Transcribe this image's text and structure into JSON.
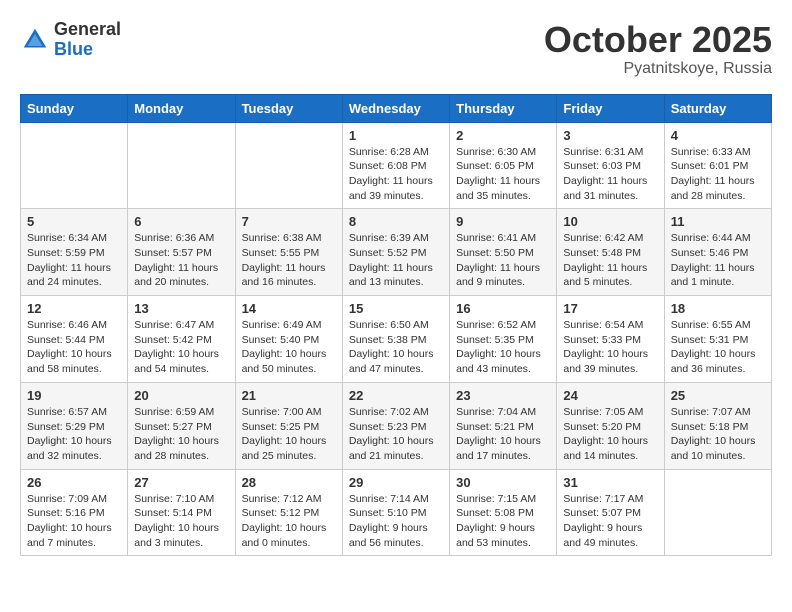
{
  "logo": {
    "general": "General",
    "blue": "Blue"
  },
  "header": {
    "month": "October 2025",
    "location": "Pyatnitskoye, Russia"
  },
  "weekdays": [
    "Sunday",
    "Monday",
    "Tuesday",
    "Wednesday",
    "Thursday",
    "Friday",
    "Saturday"
  ],
  "weeks": [
    [
      {
        "day": "",
        "info": ""
      },
      {
        "day": "",
        "info": ""
      },
      {
        "day": "",
        "info": ""
      },
      {
        "day": "1",
        "info": "Sunrise: 6:28 AM\nSunset: 6:08 PM\nDaylight: 11 hours\nand 39 minutes."
      },
      {
        "day": "2",
        "info": "Sunrise: 6:30 AM\nSunset: 6:05 PM\nDaylight: 11 hours\nand 35 minutes."
      },
      {
        "day": "3",
        "info": "Sunrise: 6:31 AM\nSunset: 6:03 PM\nDaylight: 11 hours\nand 31 minutes."
      },
      {
        "day": "4",
        "info": "Sunrise: 6:33 AM\nSunset: 6:01 PM\nDaylight: 11 hours\nand 28 minutes."
      }
    ],
    [
      {
        "day": "5",
        "info": "Sunrise: 6:34 AM\nSunset: 5:59 PM\nDaylight: 11 hours\nand 24 minutes."
      },
      {
        "day": "6",
        "info": "Sunrise: 6:36 AM\nSunset: 5:57 PM\nDaylight: 11 hours\nand 20 minutes."
      },
      {
        "day": "7",
        "info": "Sunrise: 6:38 AM\nSunset: 5:55 PM\nDaylight: 11 hours\nand 16 minutes."
      },
      {
        "day": "8",
        "info": "Sunrise: 6:39 AM\nSunset: 5:52 PM\nDaylight: 11 hours\nand 13 minutes."
      },
      {
        "day": "9",
        "info": "Sunrise: 6:41 AM\nSunset: 5:50 PM\nDaylight: 11 hours\nand 9 minutes."
      },
      {
        "day": "10",
        "info": "Sunrise: 6:42 AM\nSunset: 5:48 PM\nDaylight: 11 hours\nand 5 minutes."
      },
      {
        "day": "11",
        "info": "Sunrise: 6:44 AM\nSunset: 5:46 PM\nDaylight: 11 hours\nand 1 minute."
      }
    ],
    [
      {
        "day": "12",
        "info": "Sunrise: 6:46 AM\nSunset: 5:44 PM\nDaylight: 10 hours\nand 58 minutes."
      },
      {
        "day": "13",
        "info": "Sunrise: 6:47 AM\nSunset: 5:42 PM\nDaylight: 10 hours\nand 54 minutes."
      },
      {
        "day": "14",
        "info": "Sunrise: 6:49 AM\nSunset: 5:40 PM\nDaylight: 10 hours\nand 50 minutes."
      },
      {
        "day": "15",
        "info": "Sunrise: 6:50 AM\nSunset: 5:38 PM\nDaylight: 10 hours\nand 47 minutes."
      },
      {
        "day": "16",
        "info": "Sunrise: 6:52 AM\nSunset: 5:35 PM\nDaylight: 10 hours\nand 43 minutes."
      },
      {
        "day": "17",
        "info": "Sunrise: 6:54 AM\nSunset: 5:33 PM\nDaylight: 10 hours\nand 39 minutes."
      },
      {
        "day": "18",
        "info": "Sunrise: 6:55 AM\nSunset: 5:31 PM\nDaylight: 10 hours\nand 36 minutes."
      }
    ],
    [
      {
        "day": "19",
        "info": "Sunrise: 6:57 AM\nSunset: 5:29 PM\nDaylight: 10 hours\nand 32 minutes."
      },
      {
        "day": "20",
        "info": "Sunrise: 6:59 AM\nSunset: 5:27 PM\nDaylight: 10 hours\nand 28 minutes."
      },
      {
        "day": "21",
        "info": "Sunrise: 7:00 AM\nSunset: 5:25 PM\nDaylight: 10 hours\nand 25 minutes."
      },
      {
        "day": "22",
        "info": "Sunrise: 7:02 AM\nSunset: 5:23 PM\nDaylight: 10 hours\nand 21 minutes."
      },
      {
        "day": "23",
        "info": "Sunrise: 7:04 AM\nSunset: 5:21 PM\nDaylight: 10 hours\nand 17 minutes."
      },
      {
        "day": "24",
        "info": "Sunrise: 7:05 AM\nSunset: 5:20 PM\nDaylight: 10 hours\nand 14 minutes."
      },
      {
        "day": "25",
        "info": "Sunrise: 7:07 AM\nSunset: 5:18 PM\nDaylight: 10 hours\nand 10 minutes."
      }
    ],
    [
      {
        "day": "26",
        "info": "Sunrise: 7:09 AM\nSunset: 5:16 PM\nDaylight: 10 hours\nand 7 minutes."
      },
      {
        "day": "27",
        "info": "Sunrise: 7:10 AM\nSunset: 5:14 PM\nDaylight: 10 hours\nand 3 minutes."
      },
      {
        "day": "28",
        "info": "Sunrise: 7:12 AM\nSunset: 5:12 PM\nDaylight: 10 hours\nand 0 minutes."
      },
      {
        "day": "29",
        "info": "Sunrise: 7:14 AM\nSunset: 5:10 PM\nDaylight: 9 hours\nand 56 minutes."
      },
      {
        "day": "30",
        "info": "Sunrise: 7:15 AM\nSunset: 5:08 PM\nDaylight: 9 hours\nand 53 minutes."
      },
      {
        "day": "31",
        "info": "Sunrise: 7:17 AM\nSunset: 5:07 PM\nDaylight: 9 hours\nand 49 minutes."
      },
      {
        "day": "",
        "info": ""
      }
    ]
  ]
}
